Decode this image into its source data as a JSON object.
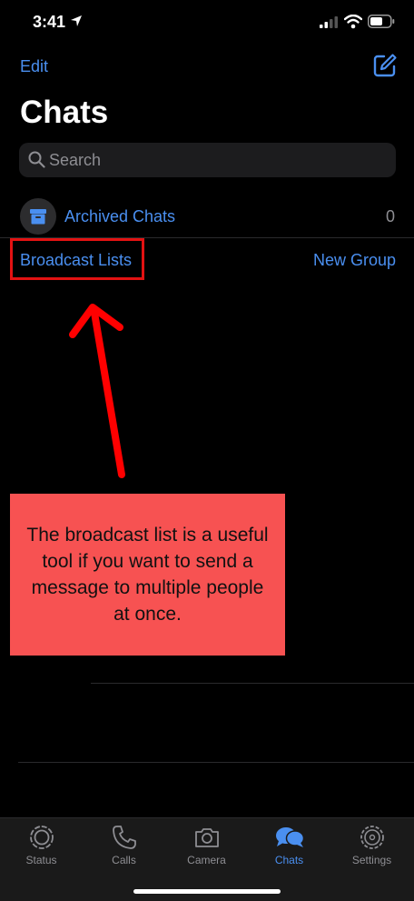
{
  "status_bar": {
    "time": "3:41"
  },
  "header": {
    "edit_label": "Edit",
    "title": "Chats"
  },
  "search": {
    "placeholder": "Search"
  },
  "archived": {
    "label": "Archived Chats",
    "count": "0"
  },
  "actions": {
    "broadcast_label": "Broadcast Lists",
    "new_group_label": "New Group"
  },
  "annotation": {
    "text": "The broadcast list is a useful tool if you want to send a message to multiple people at once.",
    "box_color": "#f75252",
    "highlight_color": "#e31212"
  },
  "tabs": [
    {
      "label": "Status",
      "icon": "status-icon",
      "active": false
    },
    {
      "label": "Calls",
      "icon": "phone-icon",
      "active": false
    },
    {
      "label": "Camera",
      "icon": "camera-icon",
      "active": false
    },
    {
      "label": "Chats",
      "icon": "chats-icon",
      "active": true
    },
    {
      "label": "Settings",
      "icon": "gear-icon",
      "active": false
    }
  ],
  "colors": {
    "accent": "#4a8ff0",
    "background": "#000000"
  }
}
